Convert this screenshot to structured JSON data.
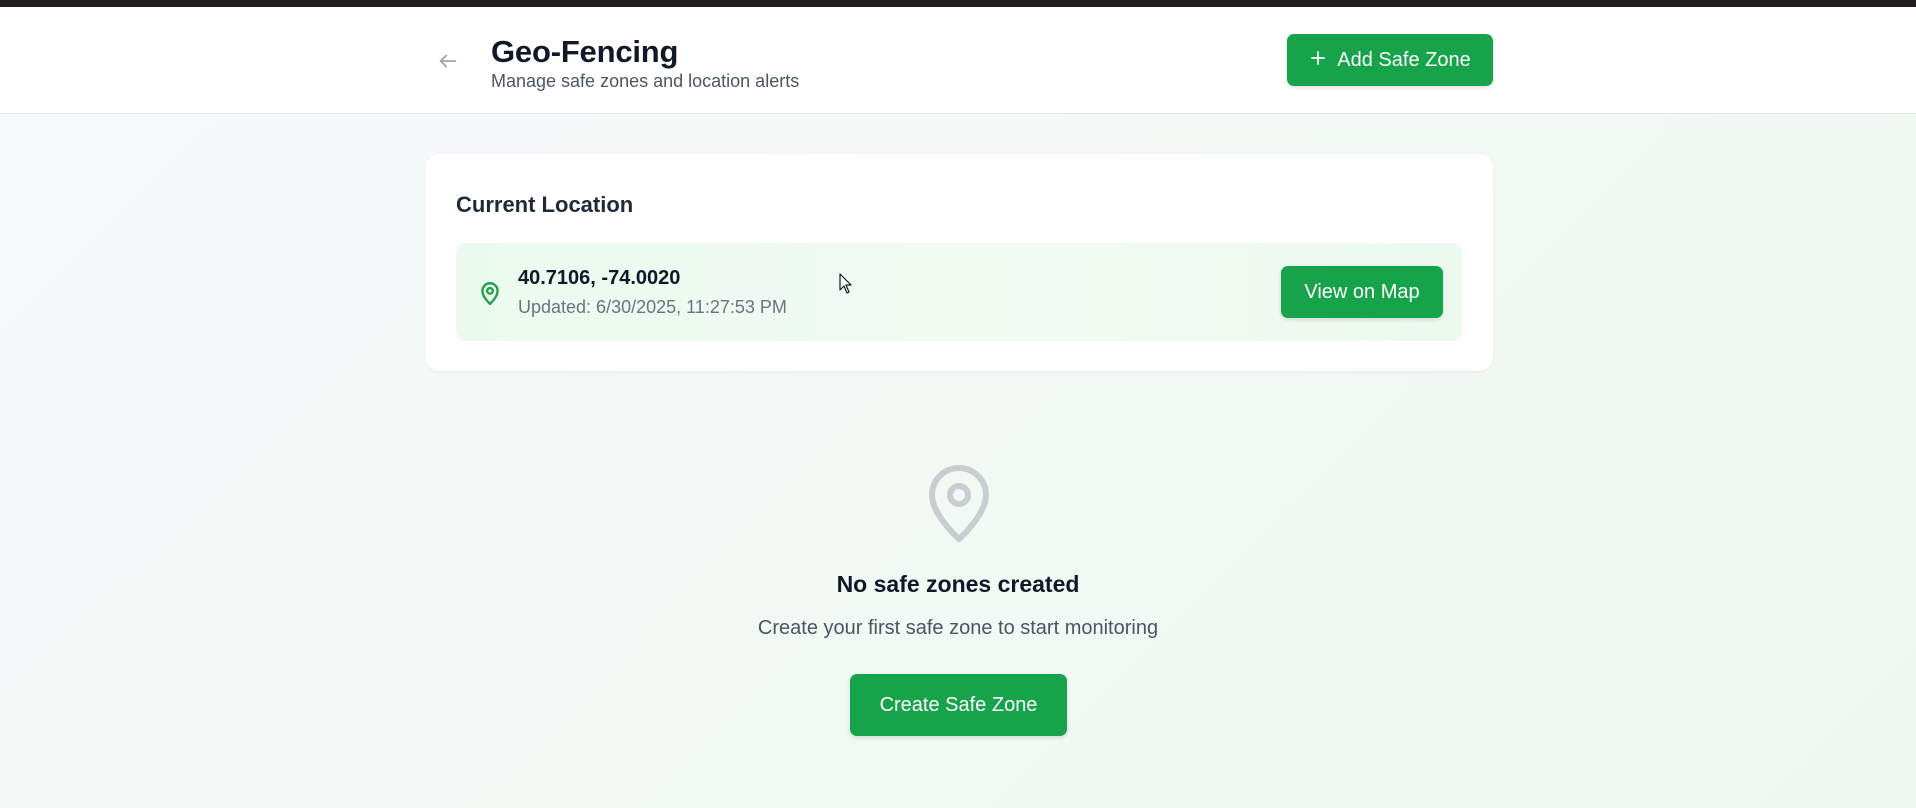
{
  "header": {
    "title": "Geo-Fencing",
    "subtitle": "Manage safe zones and location alerts",
    "add_button_label": "Add Safe Zone",
    "add_button_icon": "plus-icon",
    "back_icon": "arrow-left-icon"
  },
  "current_location": {
    "title": "Current Location",
    "coordinates": "40.7106, -74.0020",
    "updated": "Updated: 6/30/2025, 11:27:53 PM",
    "icon": "map-pin-icon",
    "view_map_label": "View on Map"
  },
  "empty_state": {
    "icon": "map-pin-icon",
    "title": "No safe zones created",
    "subtitle": "Create your first safe zone to start monitoring",
    "button_label": "Create Safe Zone"
  },
  "colors": {
    "accent": "#16a34a",
    "pin_green": "#22a04b",
    "empty_pin_gray": "#c9ccd1",
    "location_bg": "#ebfaef"
  }
}
